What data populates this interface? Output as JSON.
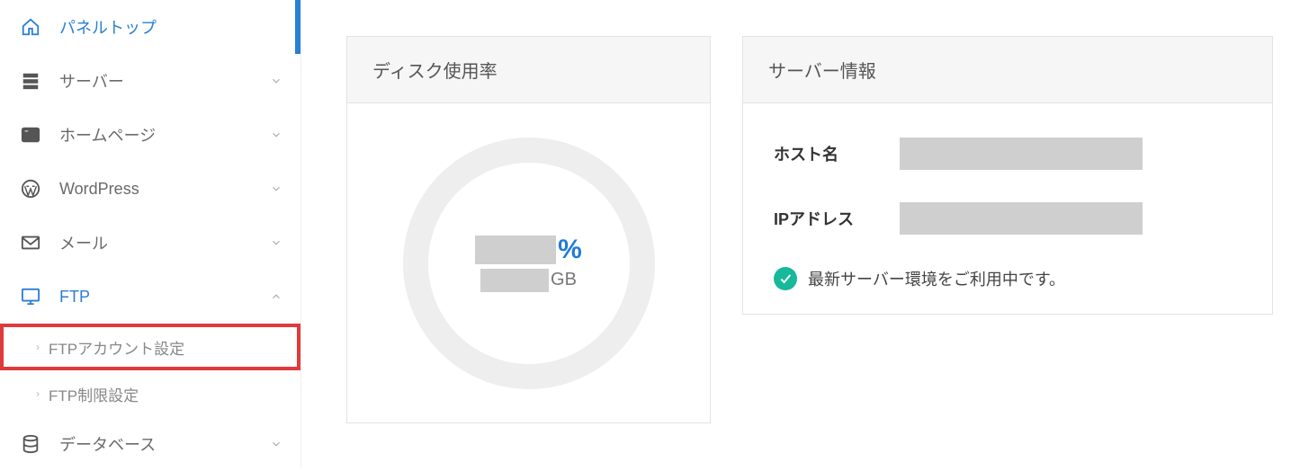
{
  "sidebar": {
    "items": [
      {
        "label": "パネルトップ",
        "icon": "home-icon",
        "active": true
      },
      {
        "label": "サーバー",
        "icon": "server-icon",
        "expandable": true
      },
      {
        "label": "ホームページ",
        "icon": "browser-icon",
        "expandable": true
      },
      {
        "label": "WordPress",
        "icon": "wordpress-icon",
        "expandable": true
      },
      {
        "label": "メール",
        "icon": "mail-icon",
        "expandable": true
      },
      {
        "label": "FTP",
        "icon": "monitor-icon",
        "expandable": true,
        "open": true
      },
      {
        "label": "データベース",
        "icon": "database-icon",
        "expandable": true
      }
    ],
    "ftp_sub": [
      {
        "label": "FTPアカウント設定",
        "highlight": true
      },
      {
        "label": "FTP制限設定"
      }
    ]
  },
  "disk": {
    "title": "ディスク使用率",
    "percent_suffix": "%",
    "gb_suffix": "GB"
  },
  "server": {
    "title": "サーバー情報",
    "host_label": "ホスト名",
    "ip_label": "IPアドレス",
    "status_text": "最新サーバー環境をご利用中です。"
  }
}
